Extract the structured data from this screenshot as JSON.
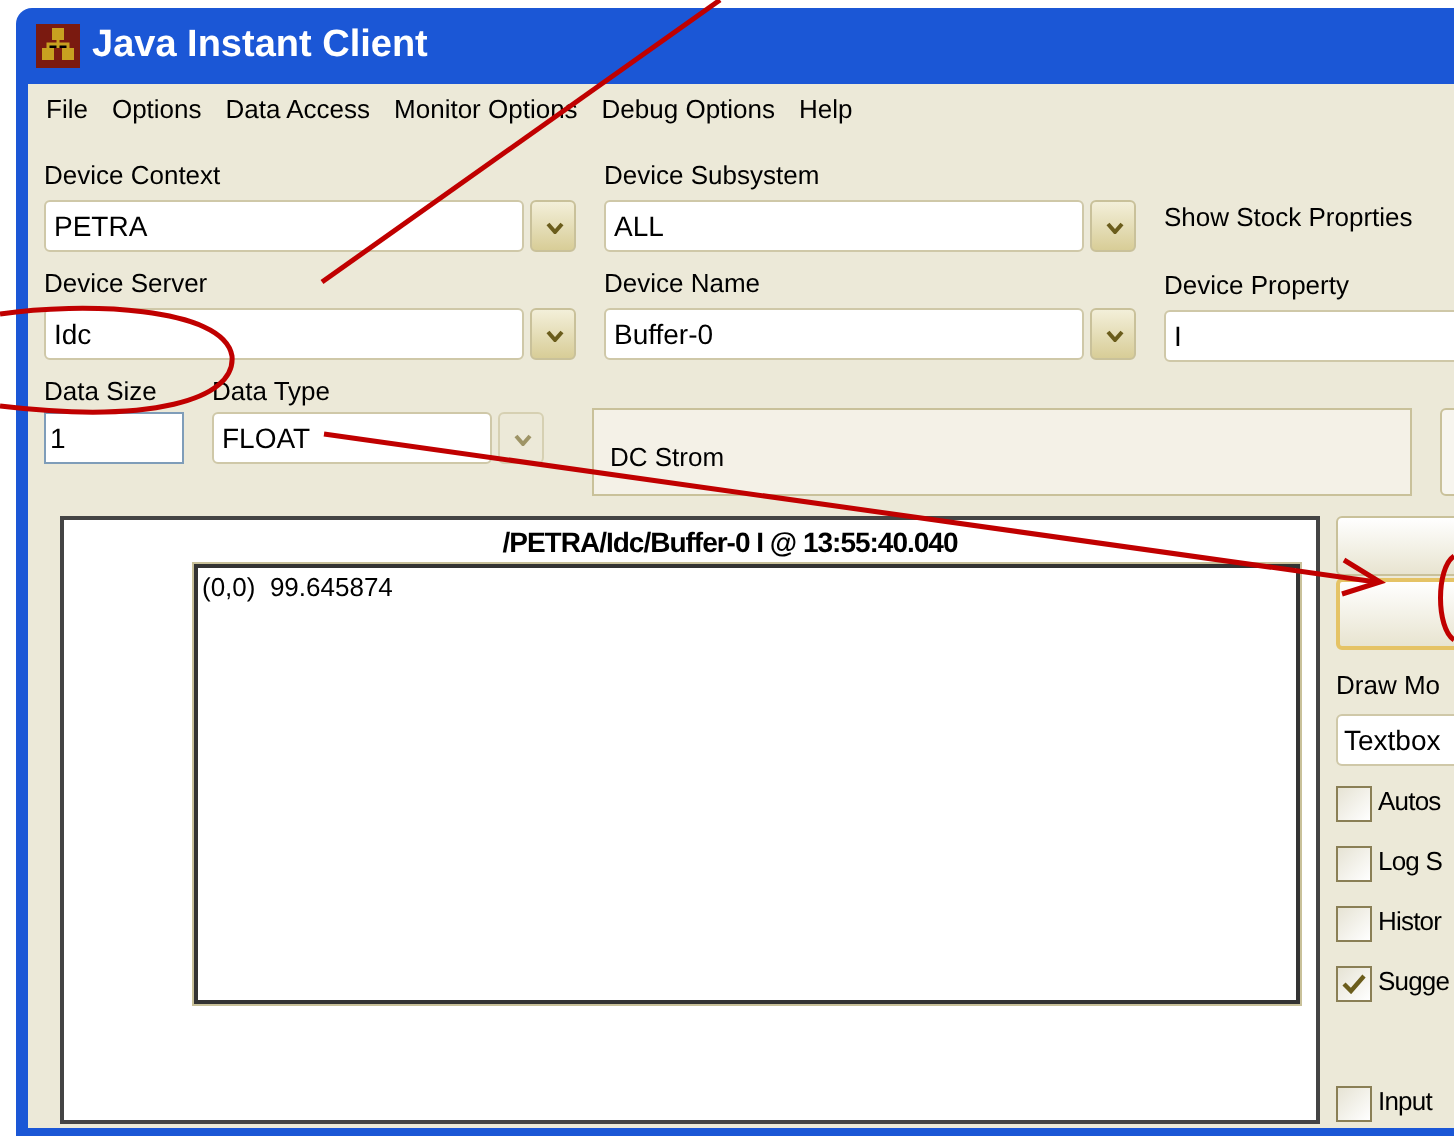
{
  "window": {
    "title": "Java Instant Client"
  },
  "menu": [
    "File",
    "Options",
    "Data Access",
    "Monitor Options",
    "Debug Options",
    "Help"
  ],
  "device_context": {
    "label": "Device Context",
    "value": "PETRA"
  },
  "device_subsystem": {
    "label": "Device Subsystem",
    "value": "ALL"
  },
  "show_stock_properties": "Show Stock Proprties",
  "device_server": {
    "label": "Device Server",
    "value": "Idc"
  },
  "device_name": {
    "label": "Device Name",
    "value": "Buffer-0"
  },
  "device_property": {
    "label": "Device Property",
    "value": "I"
  },
  "data_size": {
    "label": "Data Size",
    "value": "1"
  },
  "data_type": {
    "label": "Data Type",
    "value": "FLOAT",
    "disabled": true
  },
  "description": "DC Strom",
  "display": {
    "title": "/PETRA/Idc/Buffer-0 I @ 13:55:40.040",
    "lines": [
      "(0,0)  99.645874"
    ]
  },
  "draw_mode": {
    "label": "Draw Mo",
    "value": "Textbox"
  },
  "options": [
    {
      "label": "Autos",
      "checked": false
    },
    {
      "label": "Log S",
      "checked": false
    },
    {
      "label": "Histor",
      "checked": false
    },
    {
      "label": "Sugge",
      "checked": true
    }
  ],
  "input_option": {
    "label": "Input",
    "checked": false
  }
}
